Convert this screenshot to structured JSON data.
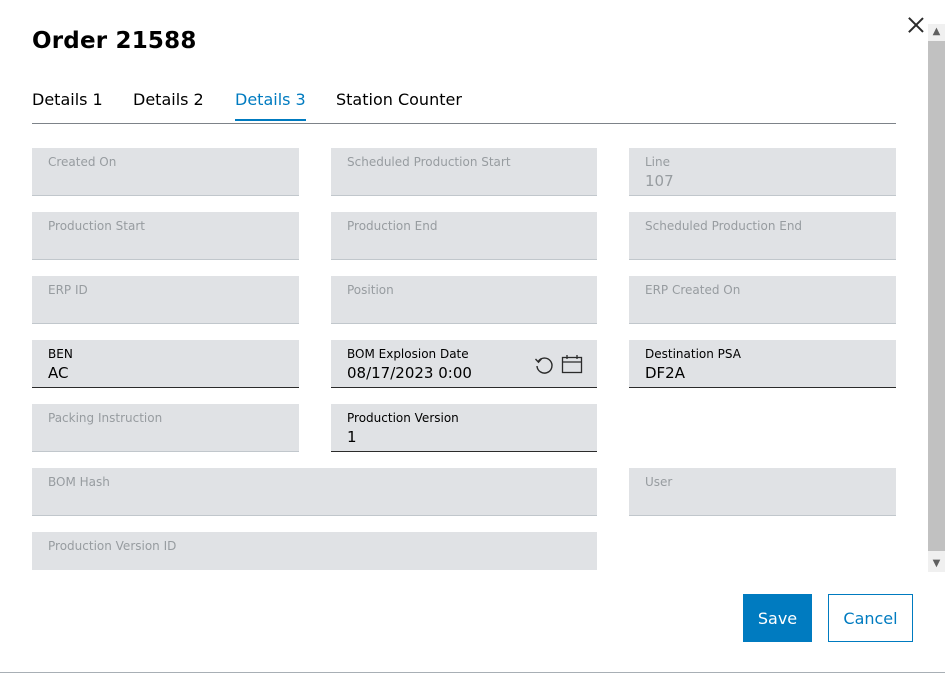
{
  "dialog": {
    "title": "Order 21588",
    "close_icon": "close-icon"
  },
  "tabs": [
    {
      "label": "Details 1"
    },
    {
      "label": "Details 2"
    },
    {
      "label": "Details 3",
      "active": true
    },
    {
      "label": "Station Counter"
    }
  ],
  "fields": {
    "created_on": {
      "label": "Created On",
      "value": ""
    },
    "scheduled_production_start": {
      "label": "Scheduled Production Start",
      "value": ""
    },
    "line": {
      "label": "Line",
      "value": "107"
    },
    "production_start": {
      "label": "Production Start",
      "value": ""
    },
    "production_end": {
      "label": "Production End",
      "value": ""
    },
    "scheduled_production_end": {
      "label": "Scheduled Production End",
      "value": ""
    },
    "erp_id": {
      "label": "ERP ID",
      "value": ""
    },
    "position": {
      "label": "Position",
      "value": ""
    },
    "erp_created_on": {
      "label": "ERP Created On",
      "value": ""
    },
    "ben": {
      "label": "BEN",
      "value": "AC"
    },
    "bom_explosion_date": {
      "label": "BOM Explosion Date",
      "value": "08/17/2023 0:00",
      "icons": [
        "reset-icon",
        "calendar-icon"
      ]
    },
    "destination_psa": {
      "label": "Destination PSA",
      "value": "DF2A"
    },
    "packing_instruction": {
      "label": "Packing Instruction",
      "value": ""
    },
    "production_version": {
      "label": "Production Version",
      "value": "1"
    },
    "bom_hash": {
      "label": "BOM Hash",
      "value": ""
    },
    "user": {
      "label": "User",
      "value": ""
    },
    "production_version_id": {
      "label": "Production Version ID",
      "value": ""
    }
  },
  "actions": {
    "save_label": "Save",
    "cancel_label": "Cancel"
  },
  "colors": {
    "accent": "#007bc0",
    "field_bg": "#e0e2e5",
    "disabled_text": "#979ca0"
  }
}
